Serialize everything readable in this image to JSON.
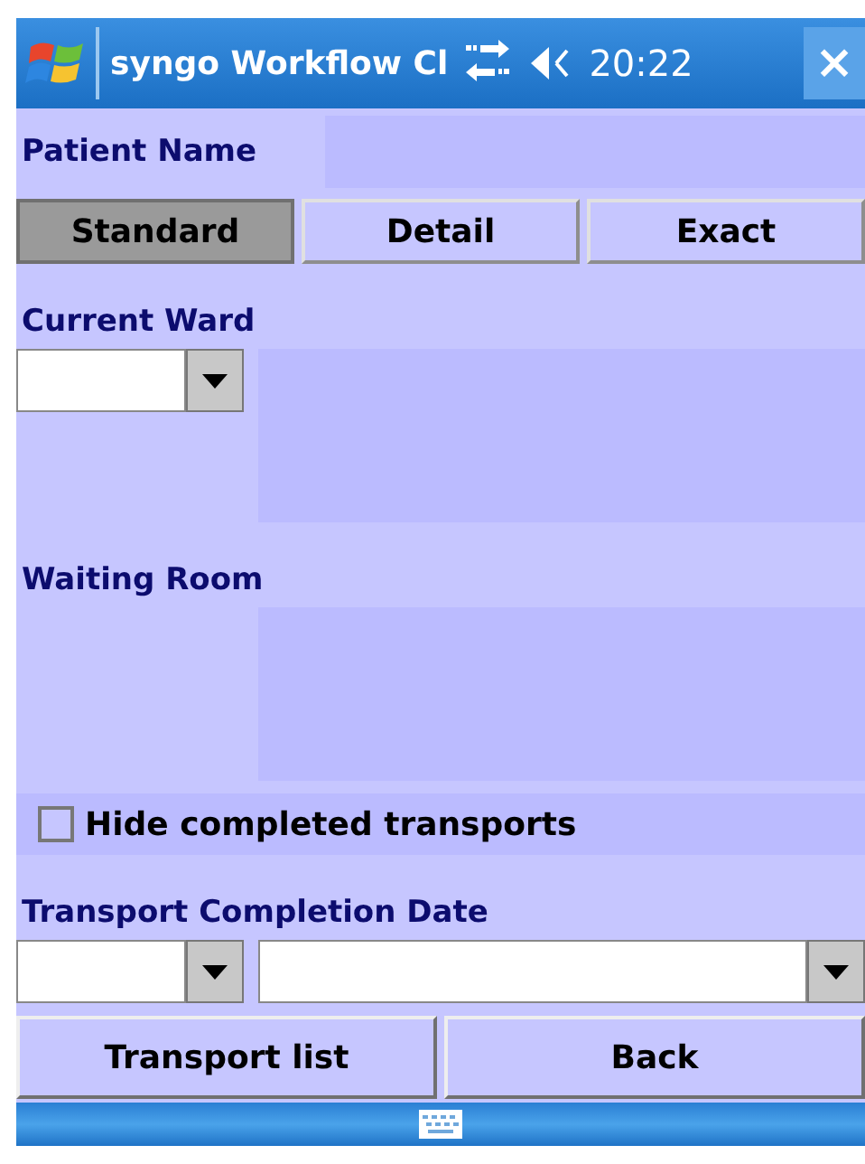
{
  "window": {
    "title": "syngo Workflow Cl",
    "time": "20:22",
    "close": "×"
  },
  "patient_name": {
    "label": "Patient Name"
  },
  "tabs": [
    {
      "label": "Standard",
      "selected": true
    },
    {
      "label": "Detail",
      "selected": false
    },
    {
      "label": "Exact",
      "selected": false
    }
  ],
  "current_ward": {
    "label": "Current Ward"
  },
  "waiting_room": {
    "label": "Waiting Room"
  },
  "hide_completed": {
    "label": "Hide completed transports",
    "checked": false
  },
  "completion_date": {
    "label": "Transport Completion Date"
  },
  "buttons": [
    "Transport list",
    "Back"
  ]
}
